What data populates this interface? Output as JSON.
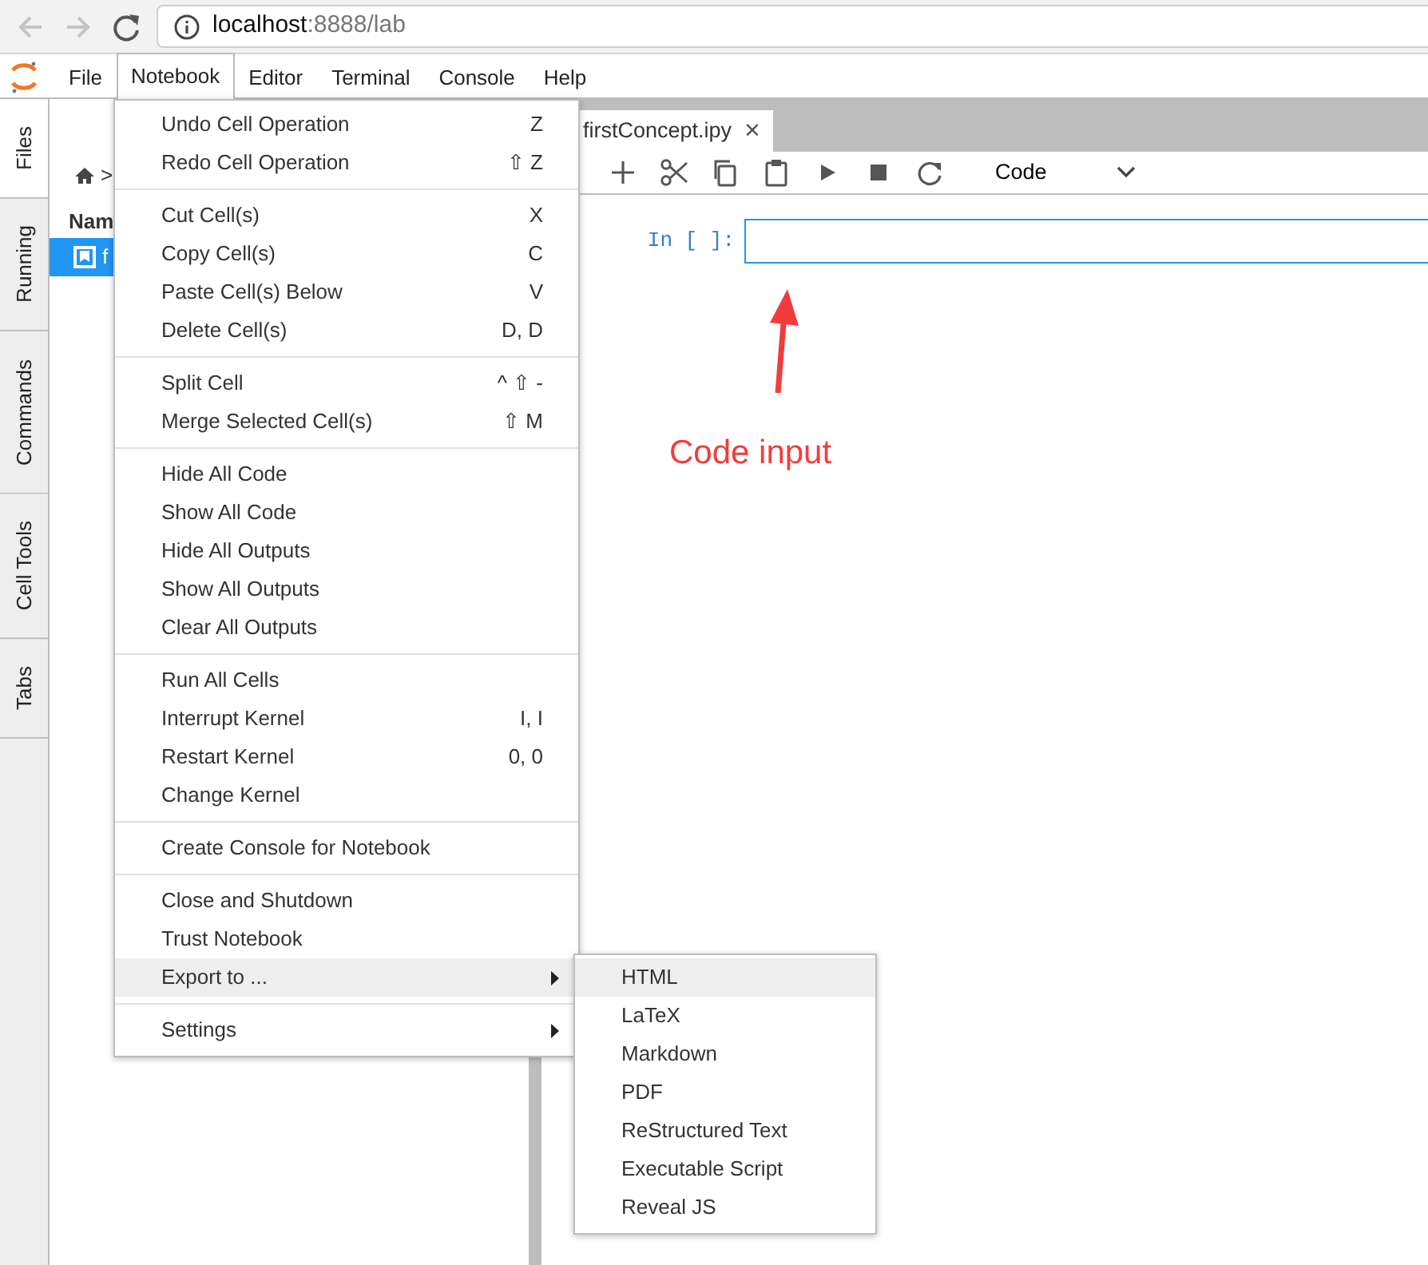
{
  "browser": {
    "host": "localhost",
    "path": ":8888/lab"
  },
  "menubar": [
    {
      "label": "File",
      "selected": false
    },
    {
      "label": "Notebook",
      "selected": true
    },
    {
      "label": "Editor",
      "selected": false
    },
    {
      "label": "Terminal",
      "selected": false
    },
    {
      "label": "Console",
      "selected": false
    },
    {
      "label": "Help",
      "selected": false
    }
  ],
  "side_tabs": [
    {
      "label": "Files",
      "selected": true
    },
    {
      "label": "Running",
      "selected": false
    },
    {
      "label": "Commands",
      "selected": false
    },
    {
      "label": "Cell Tools",
      "selected": false
    },
    {
      "label": "Tabs",
      "selected": false
    }
  ],
  "file_browser": {
    "breadcrumb_separator": ">",
    "column_header": "Nam",
    "rows": [
      {
        "name": "f",
        "selected": true
      }
    ]
  },
  "notebook_tab": {
    "title": "firstConcept.ipy",
    "close": "×"
  },
  "toolbar": {
    "cell_type": "Code"
  },
  "cell": {
    "prompt": "In [ ]:"
  },
  "annotation": {
    "label": "Code input"
  },
  "menu": {
    "groups": [
      [
        {
          "label": "Undo Cell Operation",
          "shortcut": "Z",
          "selected": false,
          "submenu": false
        },
        {
          "label": "Redo Cell Operation",
          "shortcut": "⇧ Z",
          "selected": false,
          "submenu": false
        }
      ],
      [
        {
          "label": "Cut Cell(s)",
          "shortcut": "X",
          "selected": false,
          "submenu": false
        },
        {
          "label": "Copy Cell(s)",
          "shortcut": "C",
          "selected": false,
          "submenu": false
        },
        {
          "label": "Paste Cell(s) Below",
          "shortcut": "V",
          "selected": false,
          "submenu": false
        },
        {
          "label": "Delete Cell(s)",
          "shortcut": "D, D",
          "selected": false,
          "submenu": false
        }
      ],
      [
        {
          "label": "Split Cell",
          "shortcut": "^ ⇧ -",
          "selected": false,
          "submenu": false
        },
        {
          "label": "Merge Selected Cell(s)",
          "shortcut": "⇧ M",
          "selected": false,
          "submenu": false
        }
      ],
      [
        {
          "label": "Hide All Code",
          "selected": false,
          "submenu": false
        },
        {
          "label": "Show All Code",
          "selected": false,
          "submenu": false
        },
        {
          "label": "Hide All Outputs",
          "selected": false,
          "submenu": false
        },
        {
          "label": "Show All Outputs",
          "selected": false,
          "submenu": false
        },
        {
          "label": "Clear All Outputs",
          "selected": false,
          "submenu": false
        }
      ],
      [
        {
          "label": "Run All Cells",
          "selected": false,
          "submenu": false
        },
        {
          "label": "Interrupt Kernel",
          "shortcut": "I, I",
          "selected": false,
          "submenu": false
        },
        {
          "label": "Restart Kernel",
          "shortcut": "0, 0",
          "selected": false,
          "submenu": false
        },
        {
          "label": "Change Kernel",
          "selected": false,
          "submenu": false
        }
      ],
      [
        {
          "label": "Create Console for Notebook",
          "selected": false,
          "submenu": false
        }
      ],
      [
        {
          "label": "Close and Shutdown",
          "selected": false,
          "submenu": false
        },
        {
          "label": "Trust Notebook",
          "selected": false,
          "submenu": false
        },
        {
          "label": "Export to ...",
          "selected": true,
          "submenu": true
        }
      ],
      [
        {
          "label": "Settings",
          "selected": false,
          "submenu": true
        }
      ]
    ]
  },
  "submenu": {
    "items": [
      {
        "label": "HTML",
        "selected": true
      },
      {
        "label": "LaTeX",
        "selected": false
      },
      {
        "label": "Markdown",
        "selected": false
      },
      {
        "label": "PDF",
        "selected": false
      },
      {
        "label": "ReStructured Text",
        "selected": false
      },
      {
        "label": "Executable Script",
        "selected": false
      },
      {
        "label": "Reveal JS",
        "selected": false
      }
    ]
  }
}
